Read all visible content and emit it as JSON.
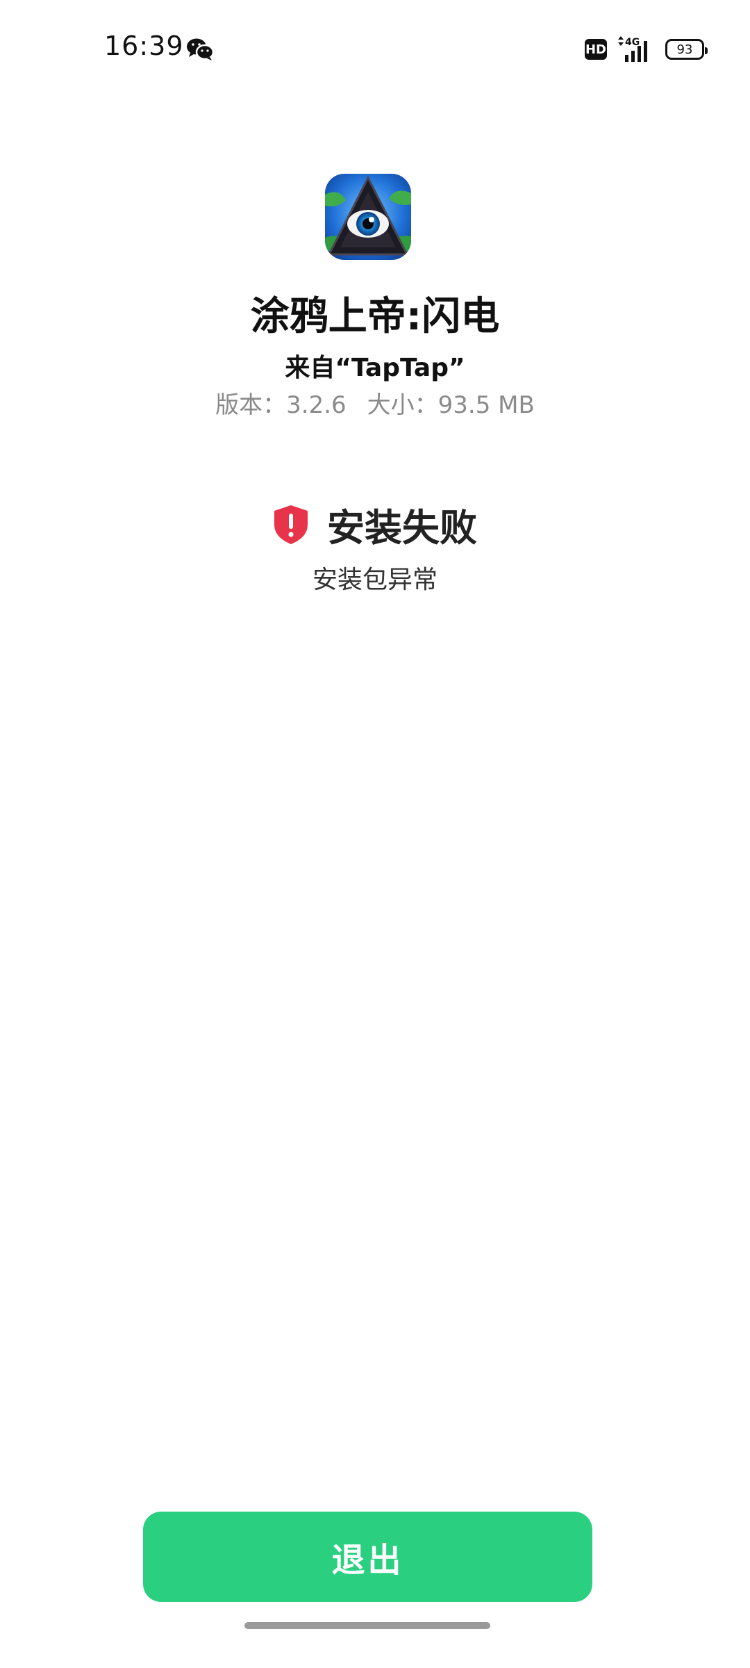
{
  "status_bar": {
    "time": "16:39",
    "hd_label": "HD",
    "network_label": "4G",
    "battery_level": "93",
    "notification_icon": "wechat-icon"
  },
  "app": {
    "icon": "eye-pyramid-app-icon",
    "name": "涂鸦上帝:闪电",
    "source": "来自“TapTap”",
    "version_text": "版本：3.2.6",
    "size_text": "大小：93.5 MB"
  },
  "install_status": {
    "icon": "shield-alert-icon",
    "title": "安装失败",
    "reason": "安装包异常",
    "icon_color": "#e8344a"
  },
  "actions": {
    "exit_label": "退出",
    "exit_color": "#2ad07f"
  }
}
